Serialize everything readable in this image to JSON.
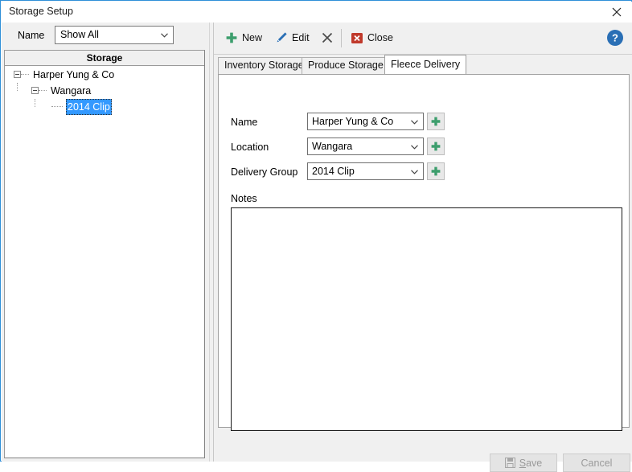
{
  "window": {
    "title": "Storage Setup",
    "close_icon": "close-x-icon"
  },
  "left_pane": {
    "filter": {
      "label": "Name",
      "value": "Show All",
      "placeholder": "Show All",
      "arrow_icon": "chevron-down-icon"
    },
    "tree": {
      "header": "Storage",
      "nodes": [
        {
          "label": "Harper Yung & Co",
          "expander": "minus-box-icon",
          "selected": false
        },
        {
          "label": "Wangara",
          "expander": "minus-box-icon",
          "selected": false
        },
        {
          "label": "2014 Clip",
          "expander": "",
          "selected": true
        }
      ]
    }
  },
  "toolbar": {
    "new_label": "New",
    "new_icon": "plus-icon",
    "edit_label": "Edit",
    "edit_icon": "pencil-icon",
    "delete_icon": "x-cross-icon",
    "close_label": "Close",
    "close_icon": "red-x-box-icon",
    "help_icon": "help-circle-icon"
  },
  "tabs": [
    {
      "label": "Inventory Storage",
      "active": false
    },
    {
      "label": "Produce Storage",
      "active": false
    },
    {
      "label": "Fleece Delivery",
      "active": true
    }
  ],
  "form": {
    "name": {
      "label": "Name",
      "value": "Harper Yung & Co",
      "placeholder": "",
      "arrow_icon": "chevron-down-icon",
      "add_icon": "plus-icon"
    },
    "location": {
      "label": "Location",
      "value": "Wangara",
      "placeholder": "",
      "arrow_icon": "chevron-down-icon",
      "add_icon": "plus-icon"
    },
    "delivery_group": {
      "label": "Delivery Group",
      "value": "2014 Clip",
      "placeholder": "",
      "arrow_icon": "chevron-down-icon",
      "add_icon": "plus-icon"
    },
    "notes": {
      "label": "Notes",
      "value": "",
      "placeholder": ""
    }
  },
  "footer": {
    "save_label": "Save",
    "save_accel": "S",
    "save_icon": "floppy-disk-icon",
    "save_enabled": false,
    "cancel_label": "Cancel",
    "cancel_enabled": false
  },
  "colors": {
    "window_border": "#2f8fd8",
    "accent_green": "#3d9e6d",
    "accent_blue": "#2a6fb5",
    "close_red": "#c0392b",
    "selection_blue": "#3399ff",
    "chrome_gray": "#f0f0f0"
  }
}
